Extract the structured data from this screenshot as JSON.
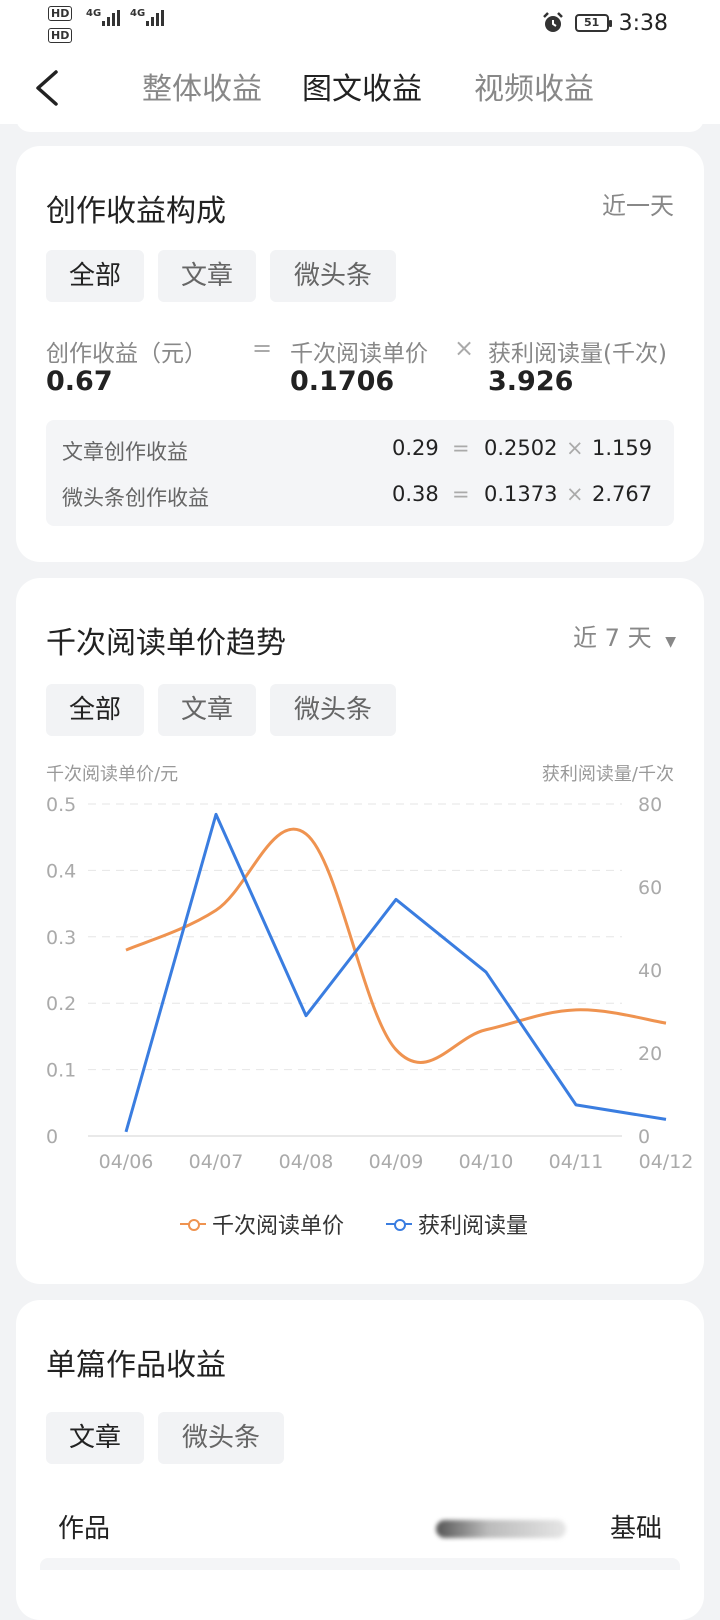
{
  "status_bar": {
    "hd1": "HD",
    "hd2": "HD",
    "net1": "4G",
    "net2": "4G",
    "battery": "51",
    "time": "3:38"
  },
  "nav": {
    "tabs": [
      {
        "label": "整体收益",
        "active": false
      },
      {
        "label": "图文收益",
        "active": true
      },
      {
        "label": "视频收益",
        "active": false
      }
    ]
  },
  "composition": {
    "title": "创作收益构成",
    "range": "近一天",
    "filters": [
      "全部",
      "文章",
      "微头条"
    ],
    "income_label": "创作收益（元）",
    "income_value": "0.67",
    "eq": "=",
    "price_label": "千次阅读单价",
    "price_value": "0.1706",
    "times": "×",
    "reads_label": "获利阅读量(千次)",
    "reads_value": "3.926",
    "details": [
      {
        "label": "文章创作收益",
        "income": "0.29",
        "price": "0.2502",
        "reads": "1.159"
      },
      {
        "label": "微头条创作收益",
        "income": "0.38",
        "price": "0.1373",
        "reads": "2.767"
      }
    ]
  },
  "trend": {
    "title": "千次阅读单价趋势",
    "range": "近 7 天",
    "filters": [
      "全部",
      "文章",
      "微头条"
    ]
  },
  "chart_data": {
    "type": "line",
    "categories": [
      "04/06",
      "04/07",
      "04/08",
      "04/09",
      "04/10",
      "04/11",
      "04/12"
    ],
    "ylabel": "千次阅读单价/元",
    "y2label": "获利阅读量/千次",
    "ylim": [
      0,
      0.5
    ],
    "y2lim": [
      0,
      80
    ],
    "yticks": [
      "0",
      "0.1",
      "0.2",
      "0.3",
      "0.4",
      "0.5"
    ],
    "y2ticks": [
      "0",
      "20",
      "40",
      "60",
      "80"
    ],
    "grid": true,
    "legend_position": "bottom",
    "series": [
      {
        "name": "千次阅读单价",
        "axis": "left",
        "smooth": true,
        "color": "#ef9350",
        "values": [
          0.28,
          0.34,
          0.455,
          0.13,
          0.16,
          0.19,
          0.17
        ]
      },
      {
        "name": "获利阅读量",
        "axis": "right",
        "smooth": false,
        "color": "#3a7de0",
        "values": [
          1.0,
          77.5,
          29.0,
          57.0,
          39.5,
          7.5,
          4.0
        ]
      }
    ]
  },
  "single": {
    "title": "单篇作品收益",
    "filters": [
      "文章",
      "微头条"
    ],
    "col_work": "作品",
    "col_base": "基础"
  }
}
